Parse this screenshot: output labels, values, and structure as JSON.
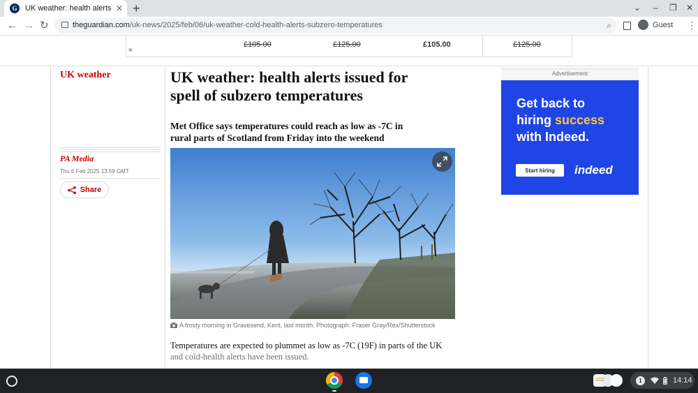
{
  "browser": {
    "tab_title": "UK weather: health alerts issued",
    "tab_close": "✕",
    "new_tab": "+",
    "url_domain": "theguardian.com",
    "url_path": "/uk-news/2025/feb/06/uk-weather-cold-health-alerts-subzero-temperatures",
    "profile_name": "Guest"
  },
  "price_bar": {
    "eq": "=",
    "prices": [
      "£105.00",
      "£125.00",
      "£105.00",
      "£125.00"
    ]
  },
  "article": {
    "section": "UK weather",
    "headline": "UK weather: health alerts issued for spell of subzero temperatures",
    "standfirst": "Met Office says temperatures could reach as low as -7C in rural parts of Scotland from Friday into the weekend",
    "author": "PA Media",
    "date": "Thu 6 Feb 2025 13.59 GMT",
    "share_label": "Share",
    "caption": "A frosty morning in Gravesend, Kent, last month. Photograph: Fraser Gray/Rex/Shutterstock",
    "body_line1": "Temperatures are expected to plummet as low as -7C (19F) in parts of the UK",
    "body_line2": "and cold-health alerts have been issued."
  },
  "ad": {
    "label": "Advertisement",
    "line1": "Get back to",
    "line2_pre": "hiring ",
    "line2_highlight": "success",
    "line3": "with Indeed.",
    "cta": "Start hiring",
    "brand": "indeed",
    "background": "#1f45e6",
    "highlight_color": "#f9c54a"
  },
  "shelf": {
    "notification_count": "1",
    "time": "14:14"
  }
}
